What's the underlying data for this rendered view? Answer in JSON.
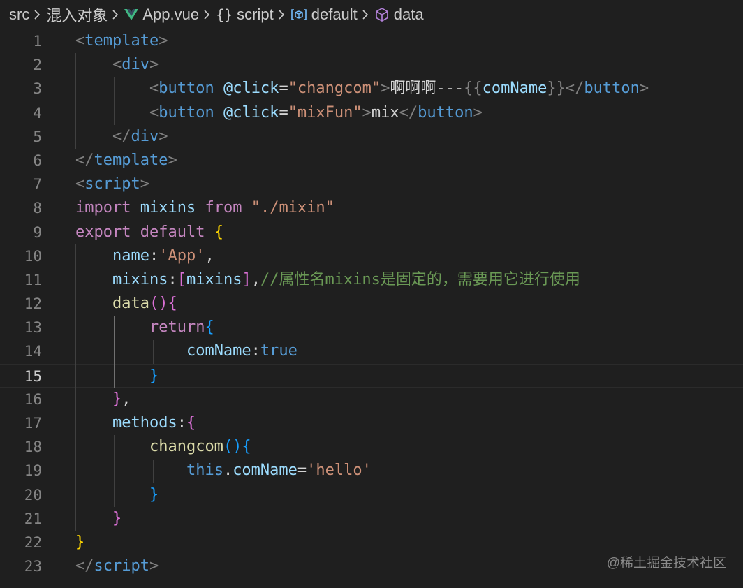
{
  "breadcrumb": {
    "items": [
      {
        "label": "src",
        "icon": ""
      },
      {
        "label": "混入对象",
        "icon": ""
      },
      {
        "label": "App.vue",
        "icon": "vue-icon"
      },
      {
        "label": "script",
        "icon": "braces-icon"
      },
      {
        "label": "default",
        "icon": "symbol-variable-icon"
      },
      {
        "label": "data",
        "icon": "cube-icon"
      }
    ],
    "separator_icon": "chevron-right-icon",
    "icon_colors": {
      "vue": "#41b883",
      "symbol": "#75beff",
      "cube": "#b180d7"
    }
  },
  "editor": {
    "current_line": 15,
    "lines": [
      {
        "n": "1",
        "tokens": [
          [
            "<",
            "punc"
          ],
          [
            "template",
            "tag"
          ],
          [
            ">",
            "punc"
          ]
        ]
      },
      {
        "n": "2",
        "tokens": [
          [
            "    ",
            "plain"
          ],
          [
            "<",
            "punc"
          ],
          [
            "div",
            "tag"
          ],
          [
            ">",
            "punc"
          ]
        ]
      },
      {
        "n": "3",
        "tokens": [
          [
            "        ",
            "plain"
          ],
          [
            "<",
            "punc"
          ],
          [
            "button",
            "tag"
          ],
          [
            " ",
            "plain"
          ],
          [
            "@click",
            "attr"
          ],
          [
            "=",
            "plain"
          ],
          [
            "\"changcom\"",
            "str"
          ],
          [
            ">",
            "punc"
          ],
          [
            "啊啊啊---",
            "plain"
          ],
          [
            "{{",
            "punc"
          ],
          [
            "comName",
            "ident"
          ],
          [
            "}}",
            "punc"
          ],
          [
            "</",
            "punc"
          ],
          [
            "button",
            "tag"
          ],
          [
            ">",
            "punc"
          ]
        ]
      },
      {
        "n": "4",
        "tokens": [
          [
            "        ",
            "plain"
          ],
          [
            "<",
            "punc"
          ],
          [
            "button",
            "tag"
          ],
          [
            " ",
            "plain"
          ],
          [
            "@click",
            "attr"
          ],
          [
            "=",
            "plain"
          ],
          [
            "\"mixFun\"",
            "str"
          ],
          [
            ">",
            "punc"
          ],
          [
            "mix",
            "plain"
          ],
          [
            "</",
            "punc"
          ],
          [
            "button",
            "tag"
          ],
          [
            ">",
            "punc"
          ]
        ]
      },
      {
        "n": "5",
        "tokens": [
          [
            "    ",
            "plain"
          ],
          [
            "</",
            "punc"
          ],
          [
            "div",
            "tag"
          ],
          [
            ">",
            "punc"
          ]
        ]
      },
      {
        "n": "6",
        "tokens": [
          [
            "</",
            "punc"
          ],
          [
            "template",
            "tag"
          ],
          [
            ">",
            "punc"
          ]
        ]
      },
      {
        "n": "7",
        "tokens": [
          [
            "<",
            "punc"
          ],
          [
            "script",
            "tag"
          ],
          [
            ">",
            "punc"
          ]
        ]
      },
      {
        "n": "8",
        "tokens": [
          [
            "import",
            "kw"
          ],
          [
            " ",
            "plain"
          ],
          [
            "mixins",
            "ident"
          ],
          [
            " ",
            "plain"
          ],
          [
            "from",
            "kw"
          ],
          [
            " ",
            "plain"
          ],
          [
            "\"./mixin\"",
            "str"
          ]
        ]
      },
      {
        "n": "9",
        "tokens": [
          [
            "export",
            "kw"
          ],
          [
            " ",
            "plain"
          ],
          [
            "default",
            "kw"
          ],
          [
            " ",
            "plain"
          ],
          [
            "{",
            "br-gold"
          ]
        ]
      },
      {
        "n": "10",
        "tokens": [
          [
            "    ",
            "plain"
          ],
          [
            "name",
            "ident"
          ],
          [
            ":",
            "plain"
          ],
          [
            "'App'",
            "str"
          ],
          [
            ",",
            "plain"
          ]
        ]
      },
      {
        "n": "11",
        "tokens": [
          [
            "    ",
            "plain"
          ],
          [
            "mixins",
            "ident"
          ],
          [
            ":",
            "plain"
          ],
          [
            "[",
            "br-pink"
          ],
          [
            "mixins",
            "ident"
          ],
          [
            "]",
            "br-pink"
          ],
          [
            ",",
            "plain"
          ],
          [
            "//属性名mixins是固定的，需要用它进行使用",
            "cmt"
          ]
        ]
      },
      {
        "n": "12",
        "tokens": [
          [
            "    ",
            "plain"
          ],
          [
            "data",
            "fn"
          ],
          [
            "(){",
            "br-pink"
          ]
        ]
      },
      {
        "n": "13",
        "tokens": [
          [
            "        ",
            "plain"
          ],
          [
            "return",
            "kw"
          ],
          [
            "{",
            "br-blue"
          ]
        ]
      },
      {
        "n": "14",
        "tokens": [
          [
            "            ",
            "plain"
          ],
          [
            "comName",
            "ident"
          ],
          [
            ":",
            "plain"
          ],
          [
            "true",
            "kwb"
          ]
        ]
      },
      {
        "n": "15",
        "tokens": [
          [
            "        ",
            "plain"
          ],
          [
            "}",
            "br-blue"
          ]
        ]
      },
      {
        "n": "16",
        "tokens": [
          [
            "    ",
            "plain"
          ],
          [
            "}",
            "br-pink"
          ],
          [
            ",",
            "plain"
          ]
        ]
      },
      {
        "n": "17",
        "tokens": [
          [
            "    ",
            "plain"
          ],
          [
            "methods",
            "ident"
          ],
          [
            ":",
            "plain"
          ],
          [
            "{",
            "br-pink"
          ]
        ]
      },
      {
        "n": "18",
        "tokens": [
          [
            "        ",
            "plain"
          ],
          [
            "changcom",
            "fn"
          ],
          [
            "(){",
            "br-blue"
          ]
        ]
      },
      {
        "n": "19",
        "tokens": [
          [
            "            ",
            "plain"
          ],
          [
            "this",
            "kwb"
          ],
          [
            ".",
            "plain"
          ],
          [
            "comName",
            "ident"
          ],
          [
            "=",
            "plain"
          ],
          [
            "'hello'",
            "str"
          ]
        ]
      },
      {
        "n": "20",
        "tokens": [
          [
            "        ",
            "plain"
          ],
          [
            "}",
            "br-blue"
          ]
        ]
      },
      {
        "n": "21",
        "tokens": [
          [
            "    ",
            "plain"
          ],
          [
            "}",
            "br-pink"
          ]
        ]
      },
      {
        "n": "22",
        "tokens": [
          [
            "}",
            "br-gold"
          ]
        ]
      },
      {
        "n": "23",
        "tokens": [
          [
            "</",
            "punc"
          ],
          [
            "script",
            "tag"
          ],
          [
            ">",
            "punc"
          ]
        ]
      }
    ]
  },
  "watermark": "@稀土掘金技术社区"
}
